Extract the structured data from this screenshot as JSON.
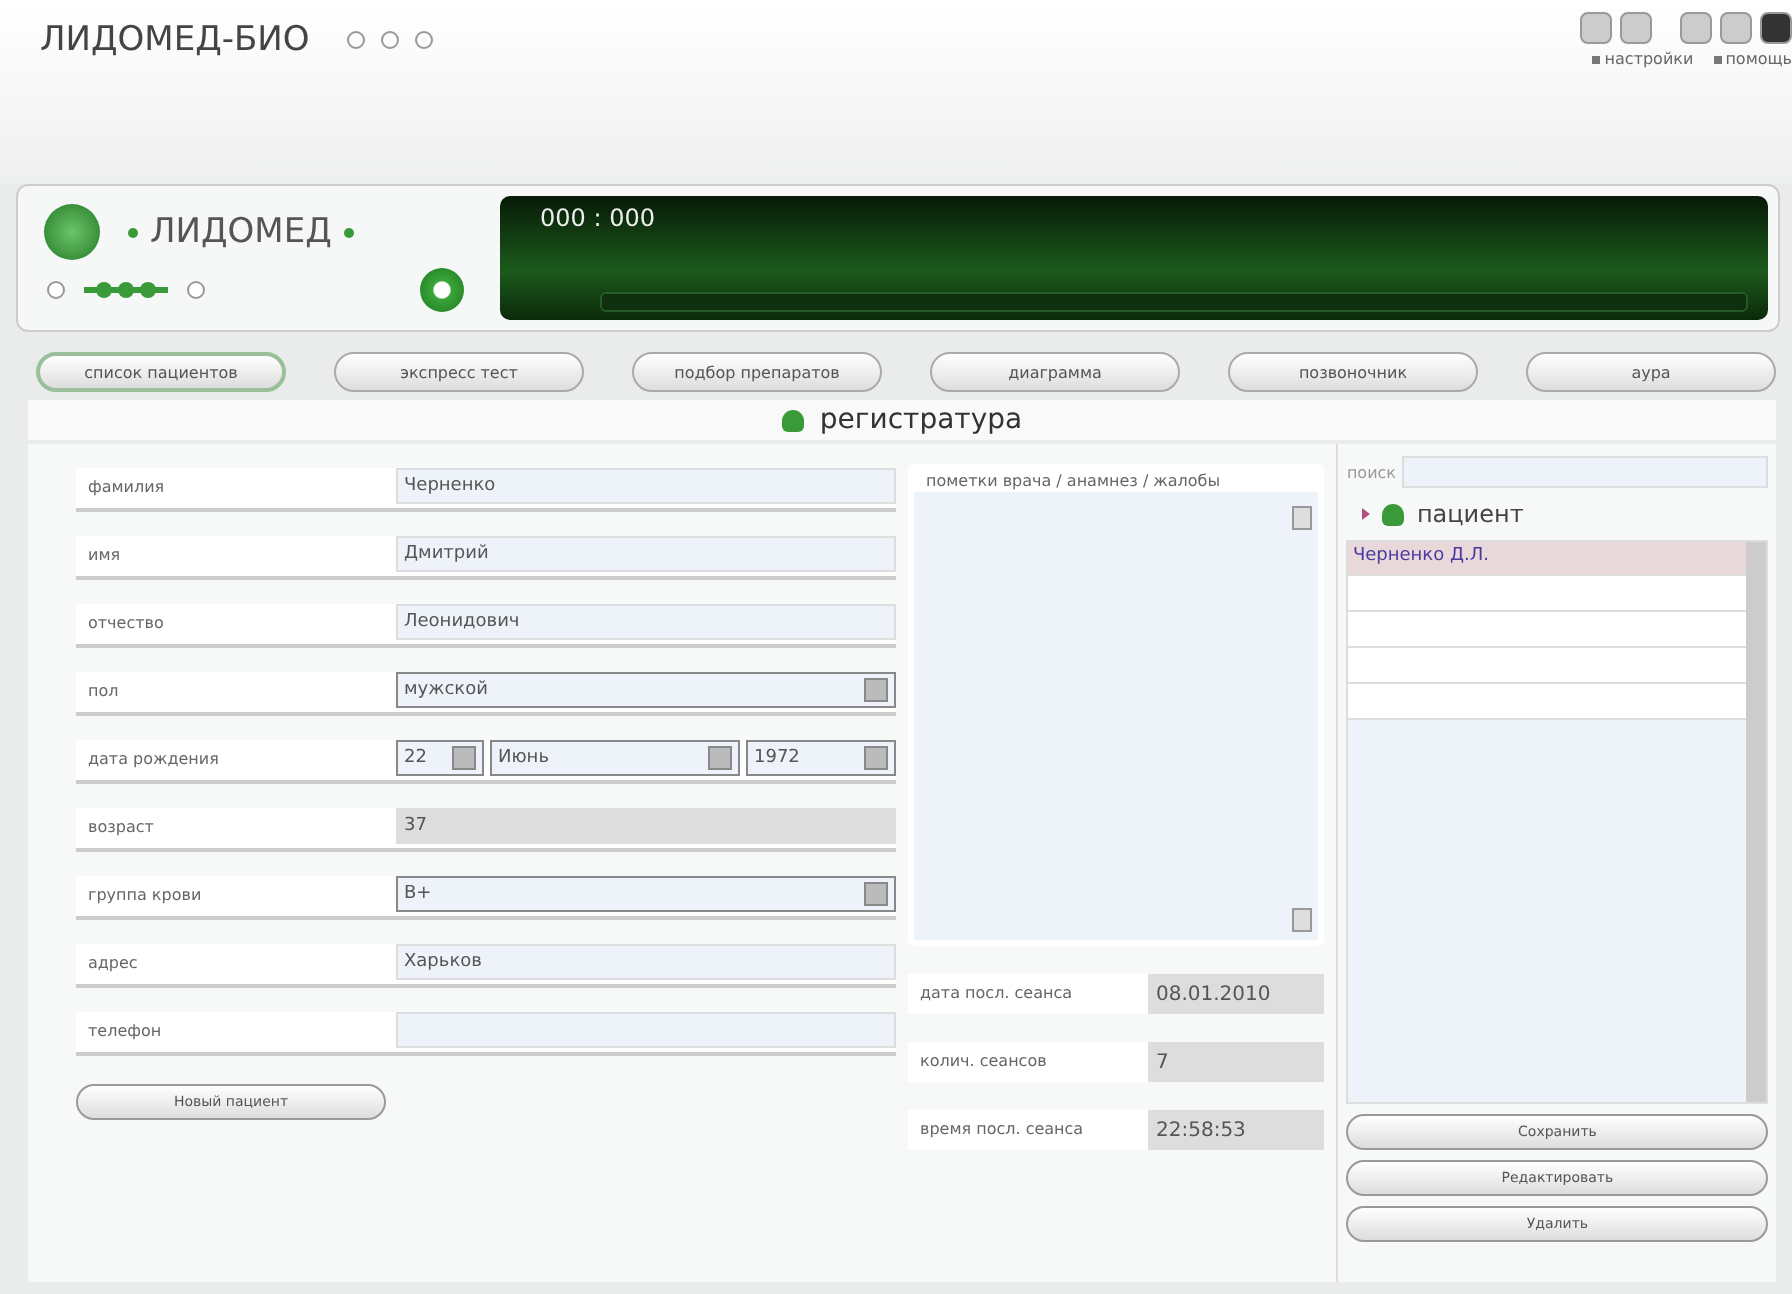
{
  "window": {
    "title": "ЛИДОМЕД-БИО",
    "links": [
      "настройки",
      "помощь"
    ]
  },
  "player": {
    "logo": "ЛИДОМЕД",
    "counter": "000 : 000"
  },
  "tabs": [
    {
      "label": "список пациентов",
      "selected": true
    },
    {
      "label": "экспресс тест",
      "selected": false
    },
    {
      "label": "подбор препаратов",
      "selected": false
    },
    {
      "label": "диаграмма",
      "selected": false
    },
    {
      "label": "позвоночник",
      "selected": false
    },
    {
      "label": "аура",
      "selected": false
    }
  ],
  "section_title": "регистратура",
  "fields": [
    {
      "kind": "text",
      "label": "фамилия",
      "value": "Черненко"
    },
    {
      "kind": "text",
      "label": "имя",
      "value": "Дмитрий"
    },
    {
      "kind": "text",
      "label": "отчество",
      "value": "Леонидович"
    },
    {
      "kind": "select",
      "label": "пол",
      "value": "мужской"
    },
    {
      "kind": "date",
      "label": "дата рождения",
      "day": "22",
      "month": "Июнь",
      "year": "1972"
    },
    {
      "kind": "readonly",
      "label": "возраст",
      "value": "37"
    },
    {
      "kind": "select",
      "label": "группа крови",
      "value": "B+"
    },
    {
      "kind": "text",
      "label": "адрес",
      "value": "Харьков"
    },
    {
      "kind": "text",
      "label": "телефон"
    }
  ],
  "new_patient_button": "Новый пациент",
  "notes": {
    "label": "пометки врача / анамнез / жалобы"
  },
  "sessions": [
    {
      "label": "дата посл. сеанса",
      "value": "08.01.2010"
    },
    {
      "label": "колич. сеансов",
      "value": "7"
    },
    {
      "label": "время посл. сеанса",
      "value": "22:58:53"
    }
  ],
  "search": {
    "label": "поиск"
  },
  "patient_tree": {
    "label": "пациент",
    "items": [
      {
        "name": "Черненко Д.Л.",
        "selected": true
      }
    ]
  },
  "actions": [
    "Сохранить",
    "Редактировать",
    "Удалить"
  ]
}
